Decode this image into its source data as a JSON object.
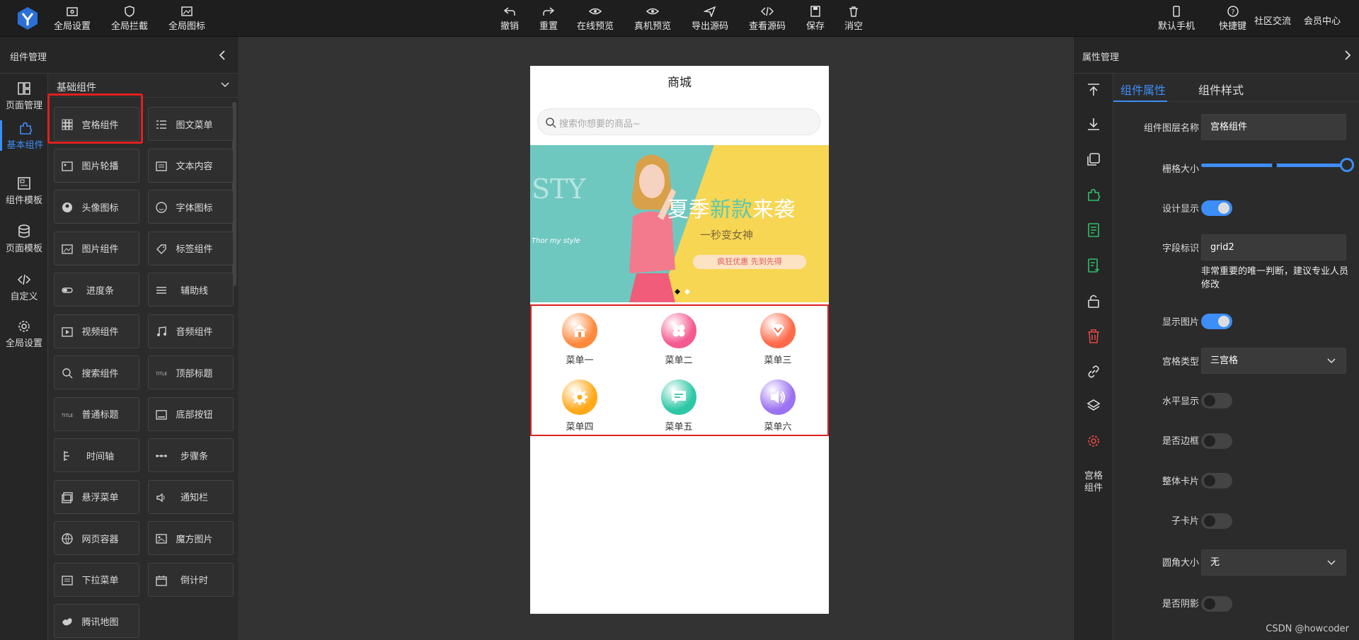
{
  "toolbar": {
    "left": [
      "全局设置",
      "全局拦截",
      "全局图标"
    ],
    "center": [
      "撤销",
      "重置",
      "在线预览",
      "真机预览",
      "导出源码",
      "查看源码",
      "保存",
      "消空"
    ],
    "right": [
      "默认手机",
      "快捷键",
      "社区交流",
      "会员中心"
    ]
  },
  "left_panel": {
    "title": "组件管理",
    "rail": [
      "页面管理",
      "基本组件",
      "组件模板",
      "页面模板",
      "自定义",
      "全局设置"
    ],
    "group_title": "基础组件",
    "components": [
      "宫格组件",
      "图文菜单",
      "图片轮播",
      "文本内容",
      "头像图标",
      "字体图标",
      "图片组件",
      "标签组件",
      "进度条",
      "辅助线",
      "视频组件",
      "音频组件",
      "搜索组件",
      "顶部标题",
      "普通标题",
      "底部按钮",
      "时间轴",
      "步骤条",
      "悬浮菜单",
      "通知栏",
      "网页容器",
      "魔方图片",
      "下拉菜单",
      "倒计时",
      "腾讯地图"
    ]
  },
  "phone": {
    "title": "商城",
    "search_placeholder": "搜索你想要的商品~",
    "banner": {
      "headline_prefix": "夏季",
      "headline_highlight": "新款",
      "headline_suffix": "来袭",
      "subline": "一秒变女神",
      "cta": "疯狂优惠  先到先得",
      "side_text": "STY",
      "script_text": "Thor my style"
    },
    "grid_items": [
      {
        "label": "菜单一",
        "icon": "home-icon",
        "color": "#ff8a3d"
      },
      {
        "label": "菜单二",
        "icon": "clover-icon",
        "color": "#f45a8f"
      },
      {
        "label": "菜单三",
        "icon": "diamond-icon",
        "color": "#ff6a4a"
      },
      {
        "label": "菜单四",
        "icon": "gear-icon",
        "color": "#ffa91a"
      },
      {
        "label": "菜单五",
        "icon": "chat-icon",
        "color": "#2dc7a6"
      },
      {
        "label": "菜单六",
        "icon": "speaker-icon",
        "color": "#9b72f2"
      }
    ]
  },
  "right_panel": {
    "title": "属性管理",
    "tool_label": "宫格\n组件",
    "tabs": [
      "组件属性",
      "组件样式"
    ],
    "props": {
      "layer_name_label": "组件图层名称",
      "layer_name_value": "宫格组件",
      "grid_size_label": "栅格大小",
      "grid_size_value": 1.0,
      "design_show_label": "设计显示",
      "field_id_label": "字段标识",
      "field_id_value": "grid2",
      "field_id_hint": "非常重要的唯一判断，建议专业人员修改",
      "show_image_label": "显示图片",
      "grid_type_label": "宫格类型",
      "grid_type_value": "三宫格",
      "horizontal_label": "水平显示",
      "border_label": "是否边框",
      "card_label": "整体卡片",
      "sub_card_label": "子卡片",
      "radius_label": "圆角大小",
      "radius_value": "无",
      "shadow_label": "是否阴影"
    },
    "toggles": {
      "design_show": true,
      "show_image": true,
      "horizontal": false,
      "border": false,
      "card": false,
      "sub_card": false,
      "shadow": false
    }
  },
  "watermark": "CSDN @howcoder"
}
